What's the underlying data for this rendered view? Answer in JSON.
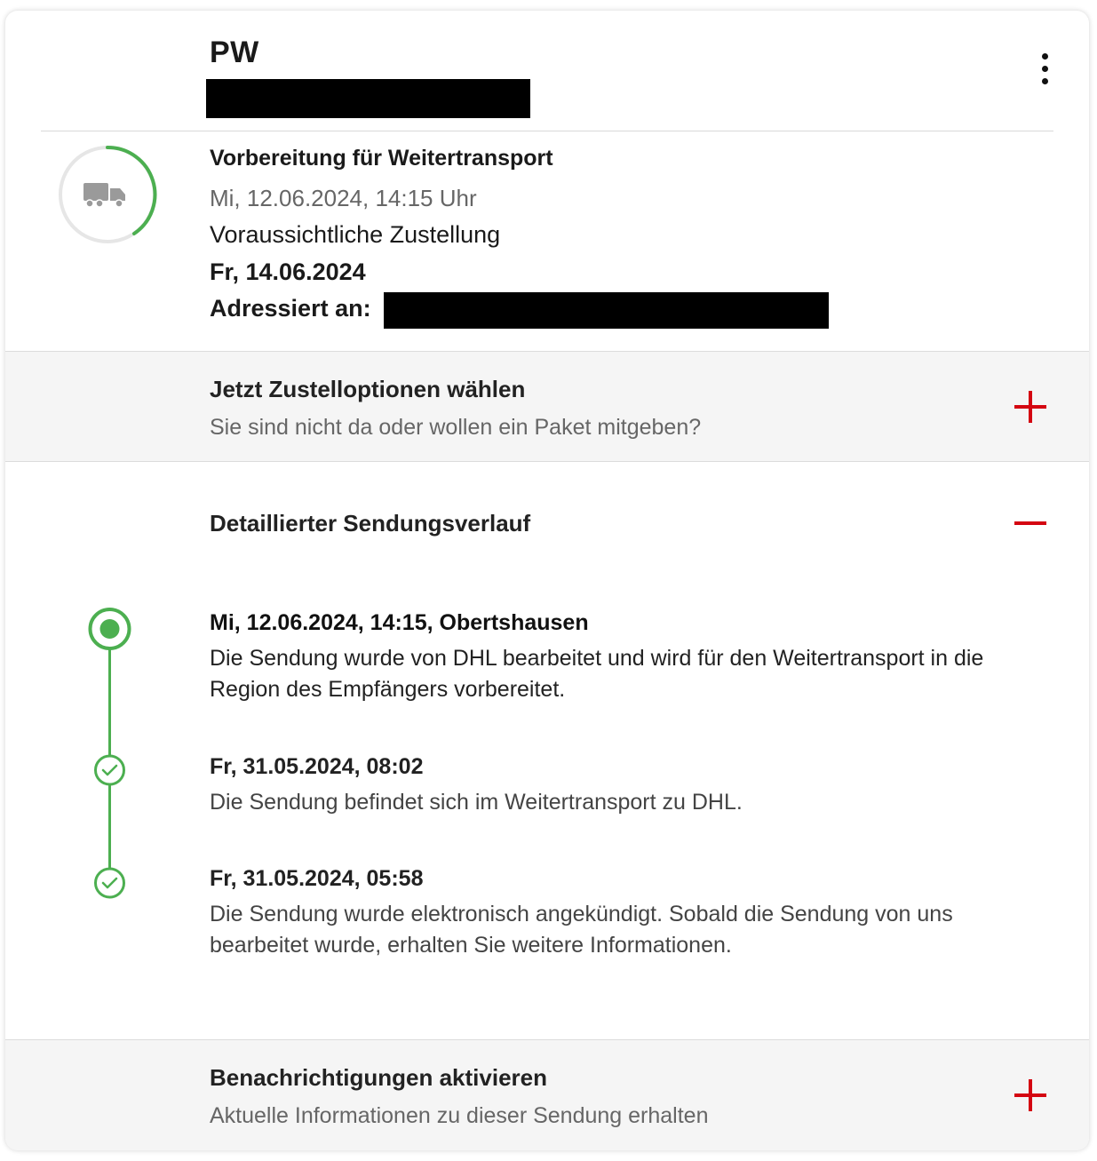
{
  "shipment": {
    "sender": "PW",
    "status": {
      "title": "Vorbereitung für Weitertransport",
      "timestamp": "Mi, 12.06.2024, 14:15 Uhr",
      "delivery_label": "Voraussichtliche Zustellung",
      "delivery_date": "Fr, 14.06.2024",
      "addressed_label": "Adressiert an:",
      "progress_icon": "truck-icon",
      "accent_color": "#4caf50"
    }
  },
  "delivery_options": {
    "title": "Jetzt Zustelloptionen wählen",
    "subtitle": "Sie sind nicht da oder wollen ein Paket mitgeben?",
    "toggle_icon": "plus-icon"
  },
  "history": {
    "title": "Detaillierter Sendungsverlauf",
    "toggle_icon": "minus-icon",
    "events": [
      {
        "date": "Mi, 12.06.2024, 14:15, Obertshausen",
        "text": "Die Sendung wurde von DHL bearbeitet und wird für den Weitertransport in die Region des Empfängers vorbereitet.",
        "marker": "current-dot-icon"
      },
      {
        "date": "Fr, 31.05.2024, 08:02",
        "text": "Die Sendung befindet sich im Weitertransport zu DHL.",
        "marker": "check-icon"
      },
      {
        "date": "Fr, 31.05.2024, 05:58",
        "text": "Die Sendung wurde elektronisch angekündigt. Sobald die Sendung von uns bearbeitet wurde, erhalten Sie weitere Informationen.",
        "marker": "check-icon"
      }
    ]
  },
  "notifications": {
    "title": "Benachrichtigungen aktivieren",
    "subtitle": "Aktuelle Informationen zu dieser Sendung erhalten",
    "toggle_icon": "plus-icon"
  },
  "colors": {
    "brand_red": "#d40511",
    "success_green": "#4caf50"
  }
}
